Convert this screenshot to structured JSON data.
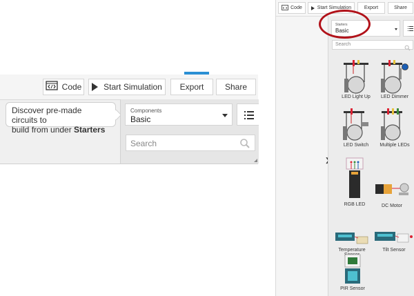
{
  "left": {
    "toolbar": {
      "code_label": "Code",
      "start_sim_label": "Start Simulation",
      "export_label": "Export",
      "share_label": "Share"
    },
    "tooltip": {
      "line1": "Discover pre-made circuits to",
      "line2_prefix": "build from under ",
      "line2_bold": "Starters"
    },
    "components_select": {
      "label": "Components",
      "value": "Basic"
    },
    "search": {
      "placeholder": "Search"
    }
  },
  "right": {
    "toolbar": {
      "code_label": "Code",
      "start_sim_label": "Start Simulation",
      "export_label": "Export",
      "share_label": "Share"
    },
    "starters_select": {
      "label": "Starters",
      "value": "Basic"
    },
    "search": {
      "placeholder": "Search"
    },
    "expand_glyph": "❯",
    "components": [
      {
        "label": "LED Light Up"
      },
      {
        "label": "LED Dimmer"
      },
      {
        "label": "LED Switch"
      },
      {
        "label": "Multiple LEDs"
      },
      {
        "label": "RGB LED"
      },
      {
        "label": "DC Motor"
      },
      {
        "label": "Temperature Sensor"
      },
      {
        "label": "Tilt Sensor"
      },
      {
        "label": "PIR Sensor"
      }
    ]
  },
  "colors": {
    "accent_blue": "#2a8fd4",
    "highlight_red": "#b1121a"
  }
}
